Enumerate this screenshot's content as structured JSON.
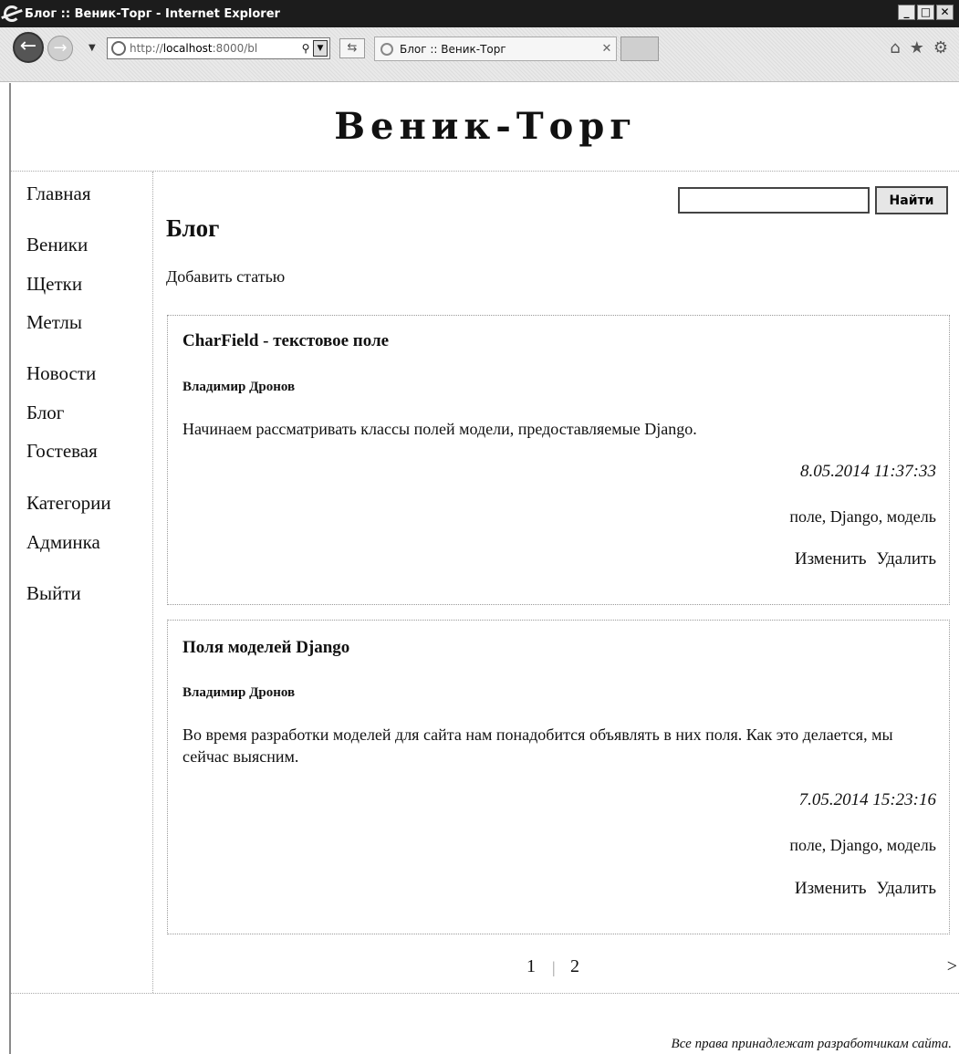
{
  "window": {
    "title": "Блог :: Веник-Торг - Internet Explorer",
    "controls": {
      "minimize": "_",
      "maximize": "□",
      "close": "✕"
    }
  },
  "browser": {
    "url_prefix": "http://",
    "url_host": "localhost",
    "url_rest": ":8000/bl",
    "search_glyph": "⚲",
    "tab_title": "Блог :: Веник-Торг",
    "tab_close": "✕",
    "icons": {
      "home": "⌂",
      "favorites": "★",
      "tools": "⚙"
    }
  },
  "site": {
    "title": "Веник-Торг",
    "footer": "Все права принадлежат разработчикам сайта."
  },
  "sidebar": {
    "items": [
      {
        "label": "Главная"
      },
      {
        "label": "Веники"
      },
      {
        "label": "Щетки"
      },
      {
        "label": "Метлы"
      },
      {
        "label": "Новости"
      },
      {
        "label": "Блог"
      },
      {
        "label": "Гостевая"
      },
      {
        "label": "Категории"
      },
      {
        "label": "Админка"
      },
      {
        "label": "Выйти"
      }
    ]
  },
  "search": {
    "value": "",
    "button_label": "Найти"
  },
  "main": {
    "heading": "Блог",
    "add_link": "Добавить статью"
  },
  "posts": [
    {
      "title": "CharField - текстовое поле",
      "author": "Владимир Дронов",
      "text": "Начинаем рассматривать классы полей модели, предоставляемые Django.",
      "date": "8.05.2014 11:37:33",
      "tags": "поле, Django, модель",
      "edit": "Изменить",
      "delete": "Удалить"
    },
    {
      "title": "Поля моделей Django",
      "author": "Владимир Дронов",
      "text": "Во время разработки моделей для сайта нам понадобится объявлять в них поля. Как это делается, мы сейчас выясним.",
      "date": "7.05.2014 15:23:16",
      "tags": "поле, Django, модель",
      "edit": "Изменить",
      "delete": "Удалить"
    }
  ],
  "pagination": {
    "pages": [
      "1",
      "2"
    ],
    "separator": "|",
    "next": ">"
  }
}
